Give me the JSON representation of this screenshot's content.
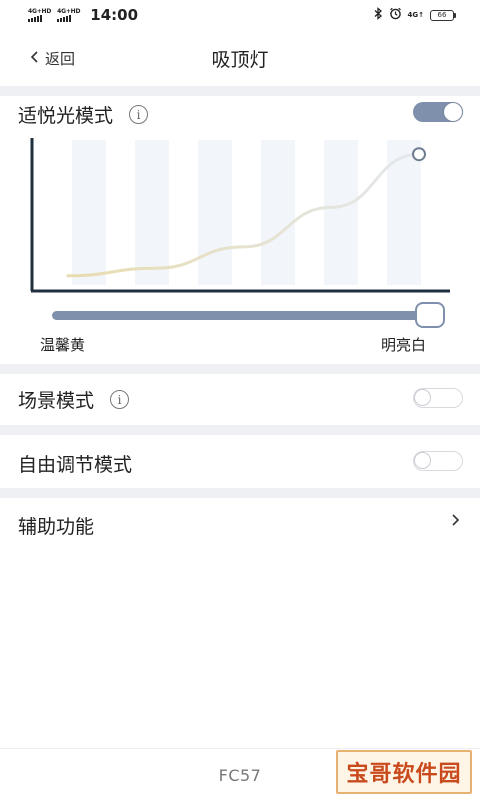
{
  "status_bar": {
    "sim1": "4G+HD",
    "sim2": "4G+HD",
    "time": "14:00",
    "net_right": "4G↑",
    "battery": "66",
    "icons": [
      "bluetooth-icon",
      "alarm-icon"
    ]
  },
  "header": {
    "back_label": "返回",
    "title": "吸顶灯"
  },
  "comfort_mode": {
    "label": "适悦光模式",
    "info_glyph": "i",
    "enabled": true,
    "slider_value": 1.0,
    "left_label": "温馨黄",
    "right_label": "明亮白"
  },
  "chart_data": {
    "type": "line",
    "title": "",
    "xlabel": "",
    "ylabel": "",
    "description_colors": [
      "#e8dcae",
      "#e4e8ee"
    ],
    "x": [
      0,
      0.25,
      0.5,
      0.75,
      1.0
    ],
    "values": [
      0.1,
      0.15,
      0.29,
      0.55,
      0.9
    ],
    "xlim": [
      0,
      1
    ],
    "ylim": [
      0,
      1
    ],
    "columns": 6,
    "grid": false
  },
  "scene_mode": {
    "label": "场景模式",
    "info_glyph": "i",
    "enabled": false
  },
  "free_mode": {
    "label": "自由调节模式",
    "enabled": false
  },
  "assist": {
    "label": "辅助功能",
    "chevron": "›"
  },
  "footer": {
    "model": "FC57"
  },
  "watermark": {
    "text": "宝哥软件园"
  },
  "colors": {
    "accent": "#7f90ad",
    "divider": "#eef0f3",
    "axis": "#1f2f3f"
  }
}
